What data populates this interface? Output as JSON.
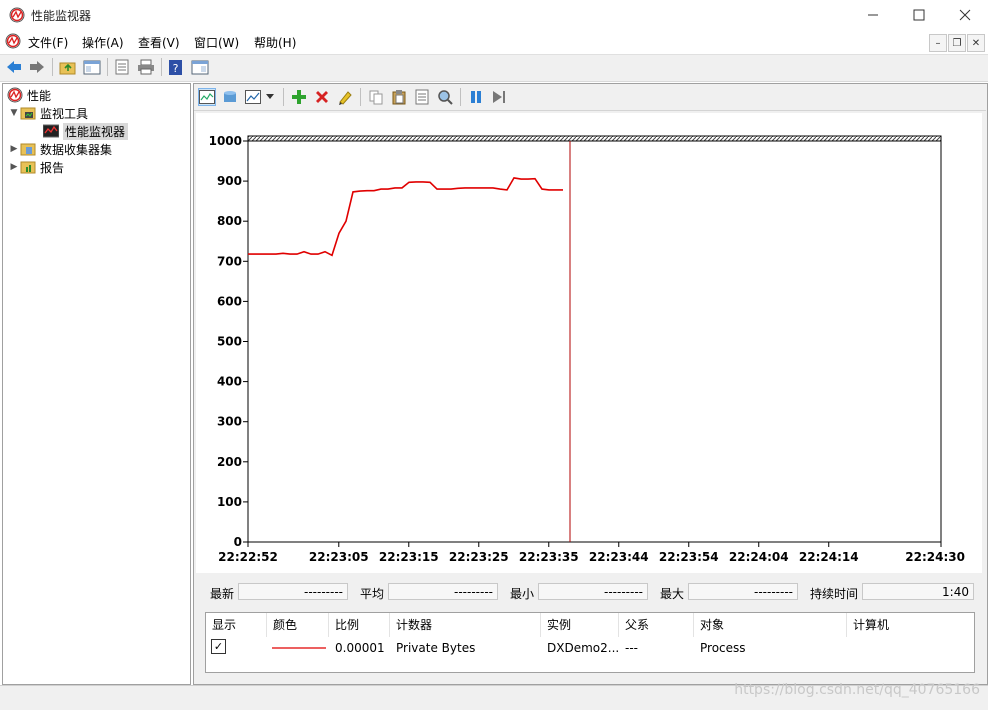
{
  "window": {
    "title": "性能监视器"
  },
  "menu": [
    "文件(F)",
    "操作(A)",
    "查看(V)",
    "窗口(W)",
    "帮助(H)"
  ],
  "tree": {
    "root": "性能",
    "monitoring_tools": "监视工具",
    "performance_monitor": "性能监视器",
    "data_collector_sets": "数据收集器集",
    "reports": "报告"
  },
  "stats": {
    "last_label": "最新",
    "last_value": "---------",
    "avg_label": "平均",
    "avg_value": "---------",
    "min_label": "最小",
    "min_value": "---------",
    "max_label": "最大",
    "max_value": "---------",
    "duration_label": "持续时间",
    "duration_value": "1:40"
  },
  "table": {
    "headers": [
      "显示",
      "颜色",
      "比例",
      "计数器",
      "实例",
      "父系",
      "对象",
      "计算机"
    ],
    "row": {
      "show": "✓",
      "scale": "0.00001",
      "counter": "Private Bytes",
      "instance": "DXDemo2...",
      "parent": "---",
      "object": "Process",
      "computer": ""
    },
    "line_color": "#e00000"
  },
  "watermark": "https://blog.csdn.net/qq_40765166",
  "chart_data": {
    "type": "line",
    "ylim": [
      0,
      1000
    ],
    "yticks": [
      "0",
      "100",
      "200",
      "300",
      "400",
      "500",
      "600",
      "700",
      "800",
      "900",
      "1000"
    ],
    "xticks": [
      "22:22:52",
      "22:23:05",
      "22:23:15",
      "22:23:25",
      "22:23:35",
      "22:23:44",
      "22:23:54",
      "22:24:04",
      "22:24:14",
      "22:24:30"
    ],
    "series": [
      {
        "color": "#e00000",
        "values": [
          718,
          718,
          718,
          718,
          718,
          720,
          718,
          718,
          724,
          718,
          718,
          724,
          715,
          770,
          800,
          873,
          875,
          876,
          876,
          880,
          880,
          883,
          883,
          897,
          898,
          898,
          897,
          880,
          880,
          880,
          882,
          883,
          883,
          883,
          883,
          883,
          880,
          878,
          908,
          905,
          905,
          906,
          880,
          878,
          878,
          878
        ]
      }
    ],
    "cursor_index": 46,
    "total_samples": 100
  }
}
